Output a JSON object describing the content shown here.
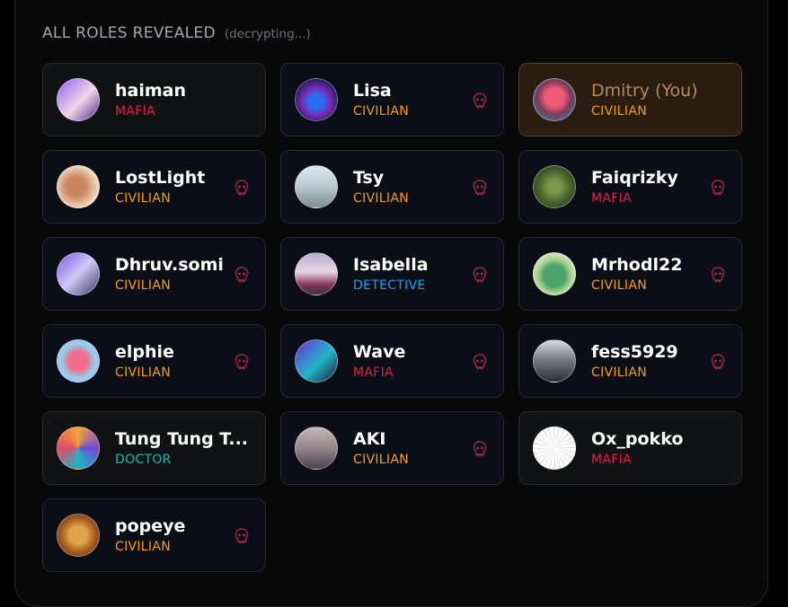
{
  "header": {
    "title": "ALL ROLES REVEALED",
    "status": "(decrypting...)"
  },
  "colors": {
    "MAFIA": "#e11d48",
    "CIVILIAN": "#f59e0b",
    "DETECTIVE": "#0ea5e9",
    "DOCTOR": "#14b8a6"
  },
  "players": [
    {
      "name": "haiman",
      "role": "MAFIA",
      "state": "dead",
      "avatar": "linear-gradient(135deg,#8f5cf0,#f2d6e8 55%,#4b2a86)"
    },
    {
      "name": "Lisa",
      "role": "CIVILIAN",
      "state": "eliminated",
      "avatar": "radial-gradient(circle at 50% 55%,#2a6cf0 0 25%,#7b2bb8 45%,#1b1f57 75%)"
    },
    {
      "name": "Dmitry (You)",
      "role": "CIVILIAN",
      "state": "self",
      "avatar": "radial-gradient(circle at 50% 45%,#f05b7a 0 30%,#7b3a5a 55%,#3e6f9a 80%)"
    },
    {
      "name": "LostLight",
      "role": "CIVILIAN",
      "state": "eliminated",
      "avatar": "radial-gradient(circle at 45% 50%,#c8845a 0 30%,#efd9c4 70%)"
    },
    {
      "name": "Tsy",
      "role": "CIVILIAN",
      "state": "eliminated",
      "avatar": "linear-gradient(180deg,#dbe9f2,#b8c7cf 50%,#7d8a90)"
    },
    {
      "name": "Faiqrizky",
      "role": "MAFIA",
      "state": "eliminated",
      "avatar": "radial-gradient(circle,#7d9a4a 0 20%,#3f5a2a 60%,#263b1c)"
    },
    {
      "name": "Dhruv.somi",
      "role": "CIVILIAN",
      "state": "eliminated",
      "avatar": "linear-gradient(135deg,#7c5ae8,#cfc7f5 50%,#3a3a58)"
    },
    {
      "name": "Isabella",
      "role": "DETECTIVE",
      "state": "eliminated",
      "avatar": "linear-gradient(180deg,#b7aacf,#e9d6e6 45%,#8a3a5b 75%,#3b2a40)"
    },
    {
      "name": "Mrhodl22",
      "role": "CIVILIAN",
      "state": "eliminated",
      "avatar": "radial-gradient(circle at 50% 55%,#4aa36a 0 35%,#a6d48a 55%,#e9e3d8 80%)"
    },
    {
      "name": "elphie",
      "role": "CIVILIAN",
      "state": "eliminated",
      "avatar": "radial-gradient(circle at 50% 50%,#f16b8a 0 30%,#8fd3f0 60%,#b9a3f5 85%)"
    },
    {
      "name": "Wave",
      "role": "MAFIA",
      "state": "eliminated",
      "avatar": "linear-gradient(135deg,#6b2bd6,#22b6c8 55%,#1d1b3d)"
    },
    {
      "name": "fess5929",
      "role": "CIVILIAN",
      "state": "eliminated",
      "avatar": "linear-gradient(180deg,#d9dbe0,#6f7480 50%,#2a2f3a)"
    },
    {
      "name": "Tung Tung T...",
      "role": "DOCTOR",
      "state": "dead",
      "avatar": "conic-gradient(#f2a23a,#6b4bd6,#20b5c0,#e24b6a,#f2a23a)"
    },
    {
      "name": "AKI",
      "role": "CIVILIAN",
      "state": "eliminated",
      "avatar": "linear-gradient(180deg,#c6b8b3,#8f8088 55%,#4a4048)"
    },
    {
      "name": "Ox_pokko",
      "role": "MAFIA",
      "state": "dead",
      "avatar": "repeating-conic-gradient(#ffffff 0 12deg,#d9d9d9 12deg 15deg)"
    },
    {
      "name": "popeye",
      "role": "CIVILIAN",
      "state": "eliminated",
      "avatar": "radial-gradient(circle,#e0a24a 0 30%,#a0581f 60%,#5a2a10)"
    }
  ]
}
